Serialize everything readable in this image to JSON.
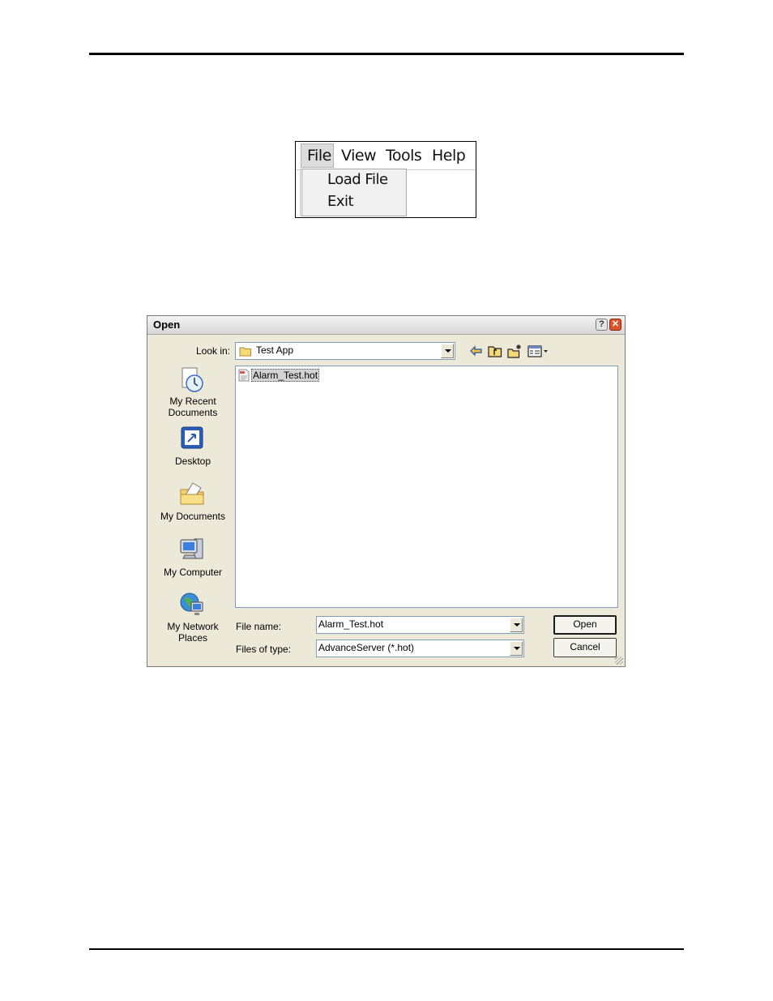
{
  "menu": {
    "items": [
      "File",
      "View",
      "Tools",
      "Help"
    ],
    "dropdown": [
      "Load File",
      "Exit"
    ]
  },
  "dialog": {
    "title": "Open",
    "help_glyph": "?",
    "close_glyph": "✕",
    "look_in_label": "Look in:",
    "look_in_value": "Test App",
    "toolbar_icons": [
      "back-arrow-icon",
      "up-folder-icon",
      "new-folder-icon",
      "view-menu-icon"
    ],
    "places": [
      "My Recent\nDocuments",
      "Desktop",
      "My Documents",
      "My Computer",
      "My Network\nPlaces"
    ],
    "files": [
      "Alarm_Test.hot"
    ],
    "file_name_label": "File name:",
    "file_name_value": "Alarm_Test.hot",
    "file_type_label": "Files of type:",
    "file_type_value": "AdvanceServer (*.hot)",
    "open_button": "Open",
    "cancel_button": "Cancel"
  }
}
